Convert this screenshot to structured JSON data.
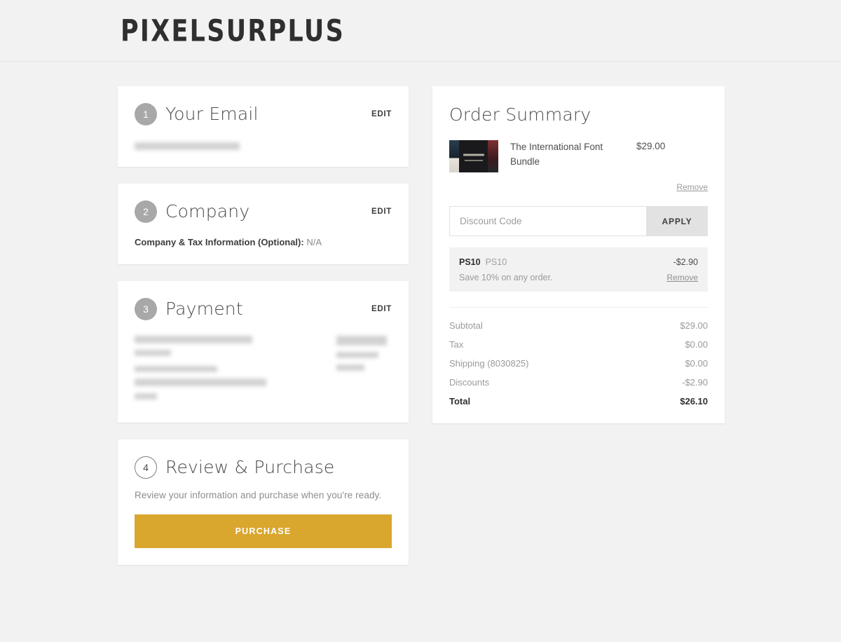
{
  "header": {
    "brand": "PIXELSURPLUS"
  },
  "steps": [
    {
      "number": "1",
      "title": "Your Email",
      "edit_label": "EDIT",
      "badge_style": "filled",
      "body_type": "redacted-email"
    },
    {
      "number": "2",
      "title": "Company",
      "edit_label": "EDIT",
      "badge_style": "filled",
      "body_type": "company",
      "company_label": "Company & Tax Information (Optional):",
      "company_value": "N/A"
    },
    {
      "number": "3",
      "title": "Payment",
      "edit_label": "EDIT",
      "badge_style": "filled",
      "body_type": "redacted-payment"
    },
    {
      "number": "4",
      "title": "Review & Purchase",
      "badge_style": "outlined",
      "body_type": "review",
      "review_text": "Review your information and purchase when you're ready.",
      "purchase_label": "PURCHASE"
    }
  ],
  "order_summary": {
    "title": "Order Summary",
    "item": {
      "name": "The International Font Bundle",
      "price": "$29.00",
      "remove_label": "Remove"
    },
    "discount": {
      "placeholder": "Discount Code",
      "value": "",
      "apply_label": "APPLY"
    },
    "applied_code": {
      "code": "PS10",
      "code_alt": "PS10",
      "amount": "-$2.90",
      "description": "Save 10% on any order.",
      "remove_label": "Remove"
    },
    "totals": [
      {
        "label": "Subtotal",
        "value": "$29.00"
      },
      {
        "label": "Tax",
        "value": "$0.00"
      },
      {
        "label": "Shipping (8030825)",
        "value": "$0.00"
      },
      {
        "label": "Discounts",
        "value": "-$2.90"
      }
    ],
    "grand_total": {
      "label": "Total",
      "value": "$26.10"
    }
  },
  "colors": {
    "page_background": "#f2f2f2",
    "card_background": "#ffffff",
    "purchase_button": "#d9a62e",
    "badge_filled": "#a8a8a8",
    "apply_button": "#e2e2e2"
  }
}
